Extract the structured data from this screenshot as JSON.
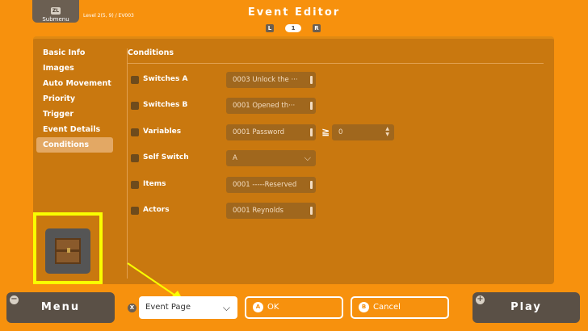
{
  "header": {
    "submenu_key": "ZL",
    "submenu_label": "Submenu",
    "level_info": "Level 2(5, 9) / EV003",
    "title": "Event Editor",
    "pager_left": "L",
    "pager_page": "1",
    "pager_right": "R"
  },
  "sidebar": {
    "items": [
      {
        "label": "Basic Info"
      },
      {
        "label": "Images"
      },
      {
        "label": "Auto Movement"
      },
      {
        "label": "Priority"
      },
      {
        "label": "Trigger"
      },
      {
        "label": "Event Details"
      },
      {
        "label": "Conditions"
      }
    ],
    "active_index": 6
  },
  "conditions": {
    "title": "Conditions",
    "rows": [
      {
        "label": "Switches A",
        "value": "0003 Unlock the ···"
      },
      {
        "label": "Switches B",
        "value": "0001 Opened th···"
      },
      {
        "label": "Variables",
        "value": "0001 Password",
        "operator": "≧",
        "number": "0"
      },
      {
        "label": "Self Switch",
        "value": "A"
      },
      {
        "label": "Items",
        "value": "0001 -----Reserved"
      },
      {
        "label": "Actors",
        "value": "0001 Reynolds"
      }
    ]
  },
  "footer": {
    "menu_label": "Menu",
    "menu_key": "−",
    "event_page_key": "X",
    "event_page_value": "Event Page",
    "ok_key": "A",
    "ok_label": "OK",
    "cancel_key": "B",
    "cancel_label": "Cancel",
    "play_label": "Play",
    "play_key": "+"
  },
  "colors": {
    "background": "#f7910d",
    "panel": "#c9780f",
    "highlight": "#f9ff00"
  }
}
